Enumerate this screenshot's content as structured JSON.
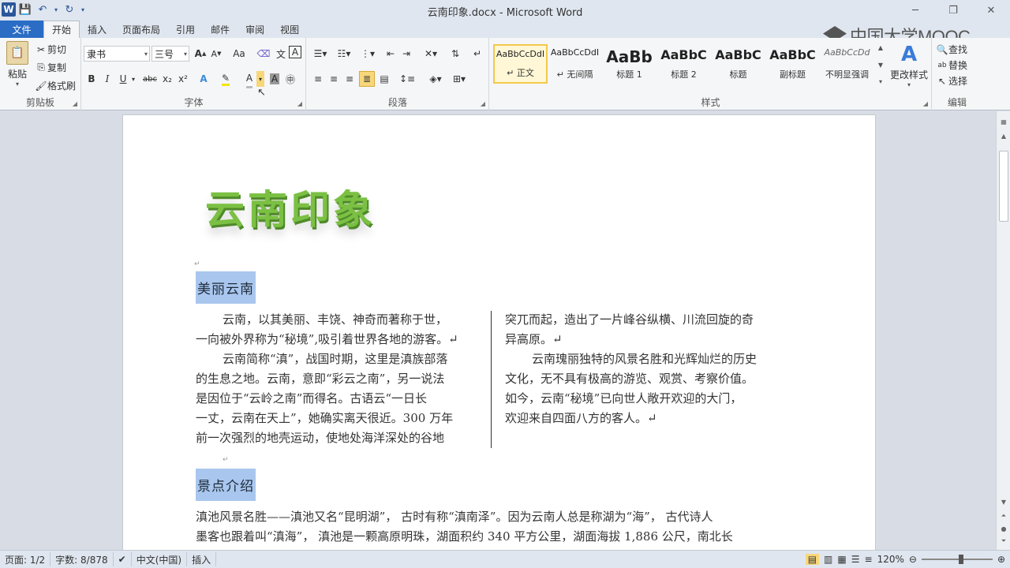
{
  "window": {
    "title": "云南印象.docx - Microsoft Word"
  },
  "quick_access": {
    "app_icon": "W"
  },
  "watermark": {
    "text": "中国大学MOOC"
  },
  "tabs": {
    "file": "文件",
    "items": [
      "开始",
      "插入",
      "页面布局",
      "引用",
      "邮件",
      "审阅",
      "视图"
    ]
  },
  "ribbon": {
    "clipboard": {
      "label": "剪贴板",
      "paste": "粘贴",
      "cut": "剪切",
      "copy": "复制",
      "format_painter": "格式刷"
    },
    "font": {
      "label": "字体",
      "font_name": "隶书",
      "font_size": "三号",
      "grow": "A",
      "shrink": "A",
      "change_case": "Aa",
      "bold": "B",
      "italic": "I",
      "underline": "U",
      "strike": "abc",
      "subscript": "x₂",
      "superscript": "x²",
      "font_color": "A"
    },
    "paragraph": {
      "label": "段落"
    },
    "styles": {
      "label": "样式",
      "change_styles": "更改样式",
      "items": [
        {
          "sample": "AaBbCcDdI",
          "name": "↵ 正文"
        },
        {
          "sample": "AaBbCcDdI",
          "name": "↵ 无间隔"
        },
        {
          "sample": "AaBb",
          "name": "标题 1"
        },
        {
          "sample": "AaBbC",
          "name": "标题 2"
        },
        {
          "sample": "AaBbC",
          "name": "标题"
        },
        {
          "sample": "AaBbC",
          "name": "副标题"
        },
        {
          "sample": "AaBbCcDd",
          "name": "不明显强调"
        }
      ]
    },
    "editing": {
      "label": "编辑",
      "find": "查找",
      "replace": "替换",
      "select": "选择"
    }
  },
  "document": {
    "wordart": "云南印象",
    "heading1": "美丽云南",
    "col1": [
      "云南，以其美丽、丰饶、神奇而著称于世，",
      "一向被外界称为“秘境”,吸引着世界各地的游客。↵",
      "云南简称“滇”，战国时期，这里是滇族部落",
      "的生息之地。云南，意即“彩云之南”，另一说法",
      "是因位于“云岭之南”而得名。古语云“一日长",
      "一丈，云南在天上”，她确实离天很近。300 万年",
      "前一次强烈的地壳运动，使地处海洋深处的谷地"
    ],
    "col2": [
      "突兀而起，造出了一片峰谷纵横、川流回旋的奇",
      "异高原。↵",
      "云南瑰丽独特的风景名胜和光辉灿烂的历史",
      "文化，无不具有极高的游览、观赏、考察价值。",
      "如今，云南“秘境”已向世人敞开欢迎的大门，",
      "欢迎来自四面八方的客人。↵"
    ],
    "heading2": "景点介绍",
    "body2": [
      "滇池风景名胜——滇池又名“昆明湖”，  古时有称“滇南泽”。因为云南人总是称湖为“海”，  古代诗人",
      "墨客也跟着叫“滇海”，  滇池是一颗高原明珠，湖面积约 340 平方公里，湖面海拔 1,886  公尺，南北长"
    ]
  },
  "statusbar": {
    "page": "页面: 1/2",
    "words": "字数: 8/878",
    "language": "中文(中国)",
    "mode": "插入",
    "zoom": "120%",
    "zoom_level": 1.2
  }
}
